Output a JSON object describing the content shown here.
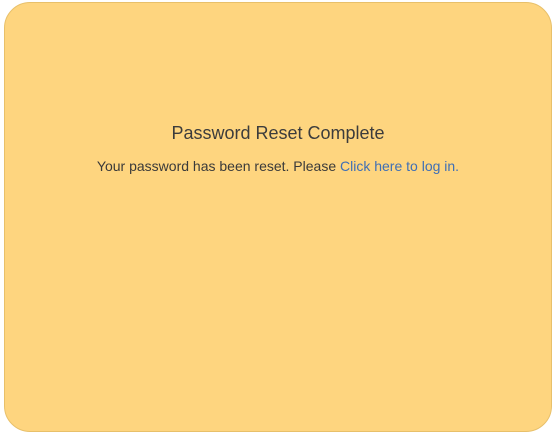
{
  "panel": {
    "title": "Password Reset Complete",
    "message_prefix": "Your password has been reset. Please ",
    "login_link": "Click here to log in."
  },
  "colors": {
    "background": "#fed57f",
    "link": "#3f6fb5",
    "text": "#3a3a3a"
  }
}
